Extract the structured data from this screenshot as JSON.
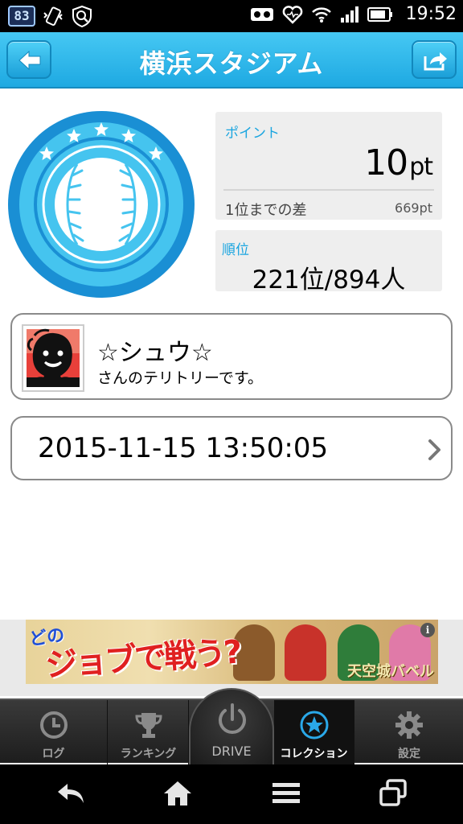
{
  "status_bar": {
    "battery_badge": "83",
    "time": "19:52"
  },
  "header": {
    "title": "横浜スタジアム",
    "back_icon": "back-arrow-icon",
    "share_icon": "share-icon",
    "accent_color": "#1ea9e2"
  },
  "stadium_badge": {
    "icon": "baseball-icon",
    "star_count": 5,
    "colors": {
      "outer": "#1a8fd4",
      "ring": "#45c4ef",
      "ball": "#ffffff",
      "stitch": "#45c4ef"
    }
  },
  "points": {
    "label": "ポイント",
    "value": "10",
    "unit": "pt",
    "gap_label": "1位までの差",
    "gap_value": "669pt"
  },
  "rank": {
    "label": "順位",
    "value": "221位/894人"
  },
  "owner": {
    "name": "☆シュウ☆",
    "subtitle": "さんのテリトリーです。"
  },
  "timestamp": {
    "value": "2015-11-15 13:50:05"
  },
  "ad": {
    "line1": "どの",
    "line2": "ジョブで戦う?",
    "brand": "天空城バベル",
    "info": "i"
  },
  "tabs": [
    {
      "label": "ログ",
      "icon": "clock-icon",
      "active": false
    },
    {
      "label": "ランキング",
      "icon": "trophy-icon",
      "active": false
    },
    {
      "label": "DRIVE",
      "icon": "power-icon",
      "active": false
    },
    {
      "label": "コレクション",
      "icon": "star-icon",
      "active": true
    },
    {
      "label": "設定",
      "icon": "gear-icon",
      "active": false
    }
  ]
}
